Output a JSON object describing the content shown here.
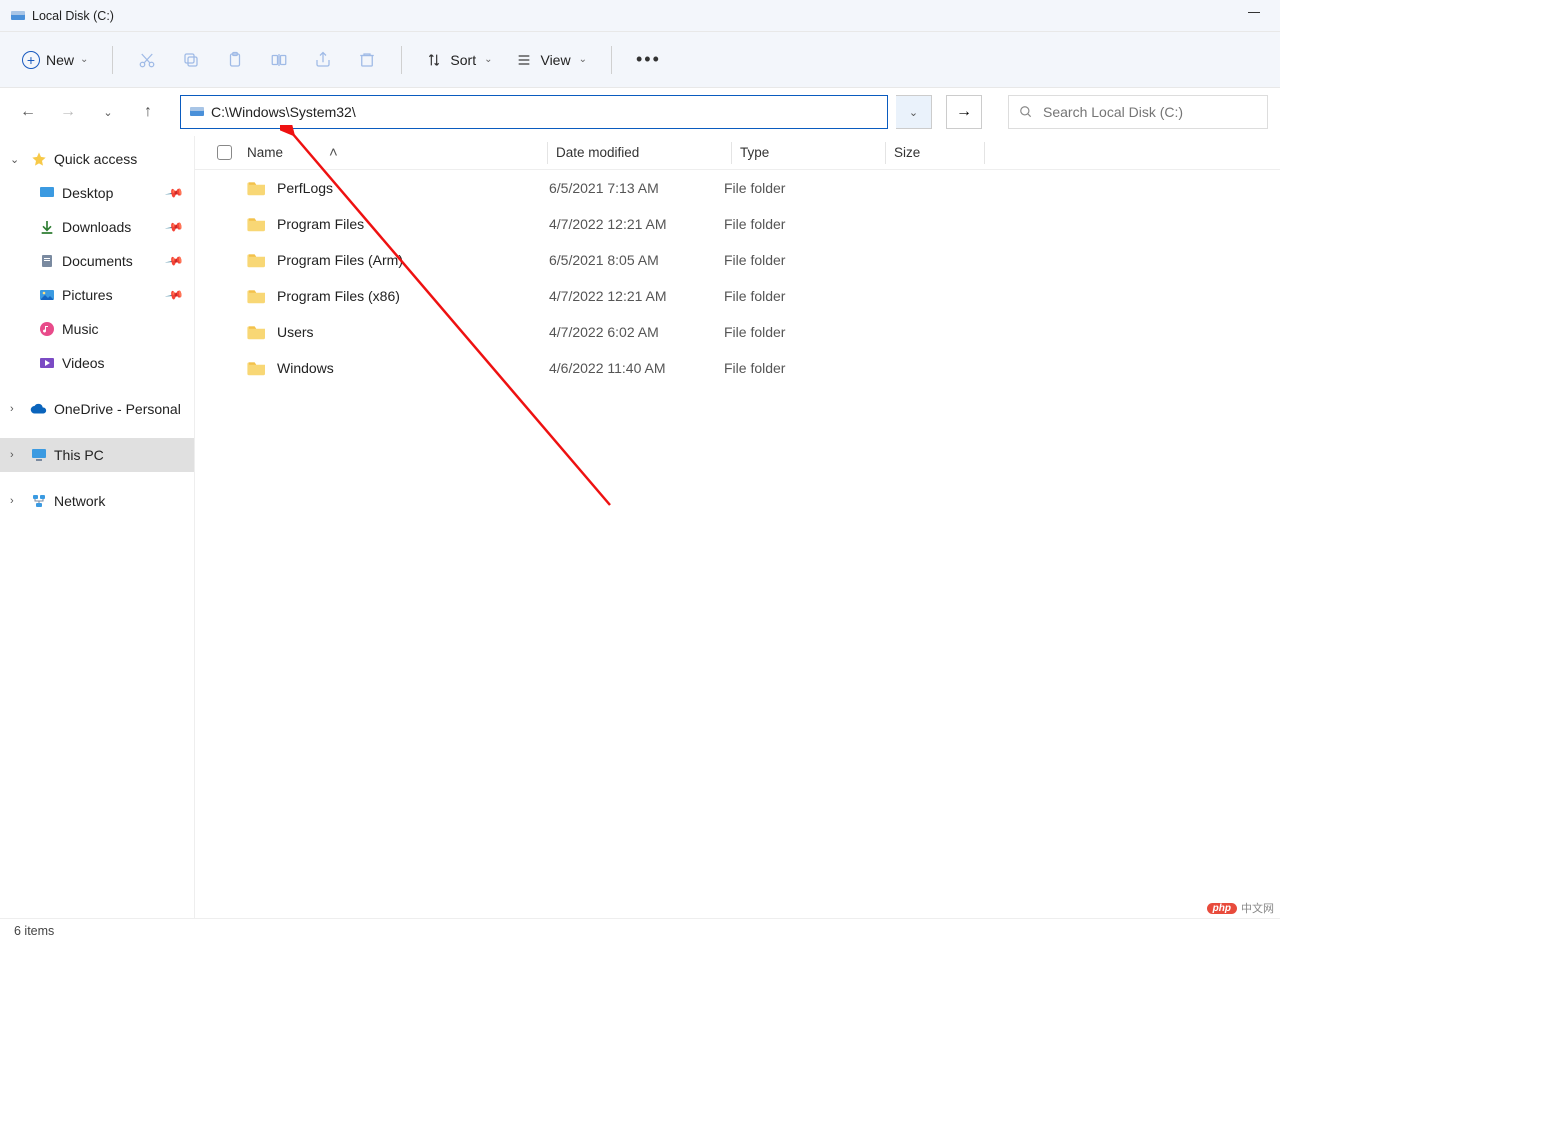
{
  "window": {
    "title": "Local Disk (C:)"
  },
  "toolbar": {
    "new": "New",
    "sort": "Sort",
    "view": "View"
  },
  "address": {
    "path": "C:\\Windows\\System32\\"
  },
  "search": {
    "placeholder": "Search Local Disk (C:)"
  },
  "sidebar": {
    "quick_access": "Quick access",
    "items": [
      {
        "label": "Desktop",
        "pinned": true
      },
      {
        "label": "Downloads",
        "pinned": true
      },
      {
        "label": "Documents",
        "pinned": true
      },
      {
        "label": "Pictures",
        "pinned": true
      },
      {
        "label": "Music",
        "pinned": false
      },
      {
        "label": "Videos",
        "pinned": false
      }
    ],
    "onedrive": "OneDrive - Personal",
    "thispc": "This PC",
    "network": "Network"
  },
  "columns": {
    "name": "Name",
    "date": "Date modified",
    "type": "Type",
    "size": "Size"
  },
  "files": [
    {
      "name": "PerfLogs",
      "date": "6/5/2021 7:13 AM",
      "type": "File folder"
    },
    {
      "name": "Program Files",
      "date": "4/7/2022 12:21 AM",
      "type": "File folder"
    },
    {
      "name": "Program Files (Arm)",
      "date": "6/5/2021 8:05 AM",
      "type": "File folder"
    },
    {
      "name": "Program Files (x86)",
      "date": "4/7/2022 12:21 AM",
      "type": "File folder"
    },
    {
      "name": "Users",
      "date": "4/7/2022 6:02 AM",
      "type": "File folder"
    },
    {
      "name": "Windows",
      "date": "4/6/2022 11:40 AM",
      "type": "File folder"
    }
  ],
  "status": {
    "count": "6 items"
  },
  "watermark": {
    "a": "php",
    "b": "中文网"
  }
}
